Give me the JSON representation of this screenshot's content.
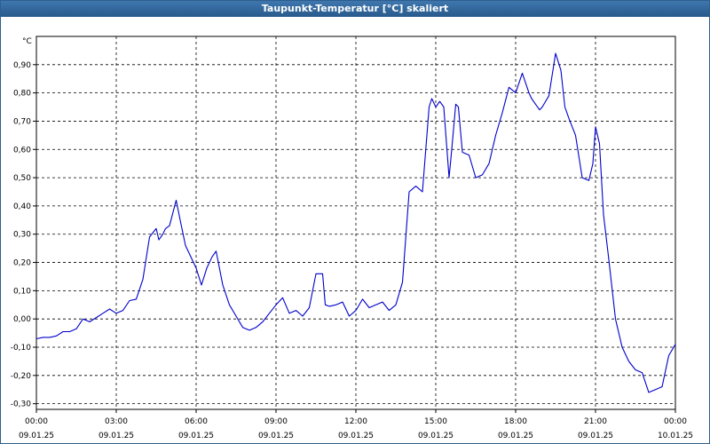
{
  "window": {
    "title": "Taupunkt-Temperatur [°C] skaliert"
  },
  "chart_data": {
    "type": "line",
    "title": "Taupunkt-Temperatur [°C] skaliert",
    "ylabel": "°C",
    "xlabel": "",
    "ylim": [
      -0.32,
      1.0
    ],
    "grid": true,
    "y_ticks": [
      "0,90",
      "0,80",
      "0,70",
      "0,60",
      "0,50",
      "0,40",
      "0,30",
      "0,20",
      "0,10",
      "0,00",
      "-0,10",
      "-0,20",
      "-0,30"
    ],
    "y_tick_values": [
      0.9,
      0.8,
      0.7,
      0.6,
      0.5,
      0.4,
      0.3,
      0.2,
      0.1,
      0.0,
      -0.1,
      -0.2,
      -0.3
    ],
    "x_ticks": [
      {
        "time": "00:00",
        "date": "09.01.25"
      },
      {
        "time": "03:00",
        "date": "09.01.25"
      },
      {
        "time": "06:00",
        "date": "09.01.25"
      },
      {
        "time": "09:00",
        "date": "09.01.25"
      },
      {
        "time": "12:00",
        "date": "09.01.25"
      },
      {
        "time": "15:00",
        "date": "09.01.25"
      },
      {
        "time": "18:00",
        "date": "09.01.25"
      },
      {
        "time": "21:00",
        "date": "09.01.25"
      },
      {
        "time": "00:00",
        "date": "10.01.25"
      }
    ],
    "series": [
      {
        "color": "#0000cc",
        "x_hours": [
          0,
          0.25,
          0.5,
          0.75,
          1,
          1.25,
          1.5,
          1.75,
          2,
          2.25,
          2.5,
          2.75,
          3,
          3.25,
          3.5,
          3.75,
          4,
          4.25,
          4.5,
          4.6,
          4.75,
          4.85,
          5,
          5.25,
          5.4,
          5.6,
          5.75,
          6,
          6.2,
          6.4,
          6.6,
          6.75,
          7,
          7.25,
          7.5,
          7.75,
          8,
          8.25,
          8.5,
          8.75,
          9,
          9.25,
          9.5,
          9.75,
          10,
          10.25,
          10.5,
          10.75,
          10.85,
          11,
          11.25,
          11.5,
          11.75,
          12,
          12.25,
          12.5,
          12.75,
          13,
          13.25,
          13.5,
          13.75,
          14,
          14.25,
          14.5,
          14.75,
          14.85,
          15,
          15.15,
          15.3,
          15.5,
          15.6,
          15.75,
          15.85,
          16,
          16.25,
          16.5,
          16.75,
          17,
          17.25,
          17.5,
          17.75,
          18,
          18.25,
          18.5,
          18.6,
          18.75,
          18.9,
          19,
          19.25,
          19.5,
          19.7,
          19.85,
          20,
          20.25,
          20.5,
          20.75,
          20.9,
          21,
          21.15,
          21.3,
          21.5,
          21.75,
          22,
          22.25,
          22.5,
          22.75,
          23,
          23.25,
          23.5,
          23.75,
          24
        ],
        "values": [
          -0.07,
          -0.065,
          -0.065,
          -0.06,
          -0.045,
          -0.045,
          -0.035,
          0.0,
          -0.01,
          0.005,
          0.02,
          0.035,
          0.02,
          0.03,
          0.065,
          0.07,
          0.14,
          0.29,
          0.32,
          0.28,
          0.3,
          0.32,
          0.33,
          0.42,
          0.35,
          0.26,
          0.23,
          0.18,
          0.12,
          0.18,
          0.22,
          0.24,
          0.12,
          0.05,
          0.01,
          -0.03,
          -0.04,
          -0.03,
          -0.01,
          0.02,
          0.05,
          0.075,
          0.02,
          0.03,
          0.01,
          0.04,
          0.16,
          0.16,
          0.05,
          0.045,
          0.05,
          0.06,
          0.01,
          0.03,
          0.07,
          0.04,
          0.05,
          0.06,
          0.03,
          0.05,
          0.13,
          0.45,
          0.47,
          0.45,
          0.75,
          0.78,
          0.75,
          0.77,
          0.75,
          0.5,
          0.6,
          0.76,
          0.75,
          0.59,
          0.58,
          0.5,
          0.51,
          0.55,
          0.65,
          0.73,
          0.82,
          0.8,
          0.87,
          0.8,
          0.78,
          0.76,
          0.74,
          0.75,
          0.79,
          0.94,
          0.88,
          0.75,
          0.71,
          0.65,
          0.5,
          0.49,
          0.55,
          0.68,
          0.62,
          0.37,
          0.21,
          0.0,
          -0.1,
          -0.15,
          -0.18,
          -0.19,
          -0.26,
          -0.25,
          -0.24,
          -0.13,
          -0.09
        ]
      }
    ]
  }
}
